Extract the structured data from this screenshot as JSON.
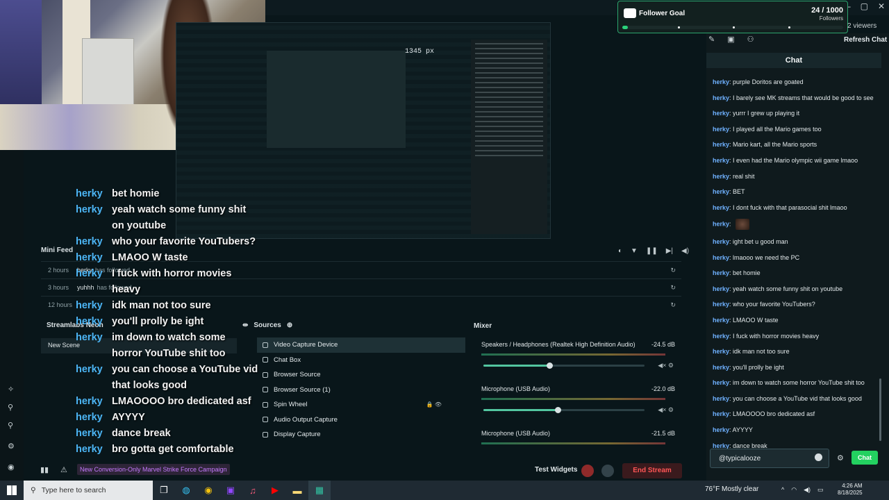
{
  "window": {
    "controls": [
      "—",
      "▢",
      "✕"
    ]
  },
  "preview": {
    "measure_label": "1345 px"
  },
  "follower_goal": {
    "title": "Follower Goal",
    "count": "24 / 1000",
    "unit": "Followers",
    "progress": 0.024,
    "accent": "#2ca56e"
  },
  "viewers": "2 viewers",
  "chat_panel": {
    "refresh_label": "Refresh Chat",
    "header": "Chat",
    "input_value": "@typicalooze",
    "send_label": "Chat",
    "messages": [
      {
        "user": "herky",
        "text": "purple Doritos are goated"
      },
      {
        "user": "herky",
        "text": "I barely see MK streams that would be good to see"
      },
      {
        "user": "herky",
        "text": "yurrr I grew up playing it"
      },
      {
        "user": "herky",
        "text": "I played all the Mario games too"
      },
      {
        "user": "herky",
        "text": "Mario kart, all the Mario sports"
      },
      {
        "user": "herky",
        "text": "I even had the Mario olympic wii game lmaoo"
      },
      {
        "user": "herky",
        "text": "real shit"
      },
      {
        "user": "herky",
        "text": "BET"
      },
      {
        "user": "herky",
        "text": "I dont fuck with that parasocial shit lmaoo"
      },
      {
        "user": "herky",
        "text": ""
      },
      {
        "user": "herky",
        "text": "ight bet u good man"
      },
      {
        "user": "herky",
        "text": "lmaooo we need the PC"
      },
      {
        "user": "herky",
        "text": "bet homie"
      },
      {
        "user": "herky",
        "text": "yeah watch some funny shit on youtube"
      },
      {
        "user": "herky",
        "text": "who your favorite YouTubers?"
      },
      {
        "user": "herky",
        "text": "LMAOO W taste"
      },
      {
        "user": "herky",
        "text": "I fuck with horror movies heavy"
      },
      {
        "user": "herky",
        "text": "idk man not too sure"
      },
      {
        "user": "herky",
        "text": "you'll prolly be ight"
      },
      {
        "user": "herky",
        "text": "im down to watch some horror YouTube shit too"
      },
      {
        "user": "herky",
        "text": "you can choose a YouTube vid that looks good"
      },
      {
        "user": "herky",
        "text": "LMAOOOO bro dedicated asf"
      },
      {
        "user": "herky",
        "text": "AYYYY"
      },
      {
        "user": "herky",
        "text": "dance break"
      },
      {
        "user": "herky",
        "text": "bro gotta get comfortable"
      }
    ]
  },
  "overlay_chat": [
    {
      "user": "herky",
      "lines": [
        "bet homie"
      ]
    },
    {
      "user": "herky",
      "lines": [
        "yeah watch some funny shit",
        "on youtube"
      ]
    },
    {
      "user": "herky",
      "lines": [
        "who your favorite YouTubers?"
      ]
    },
    {
      "user": "herky",
      "lines": [
        "LMAOO W taste"
      ]
    },
    {
      "user": "herky",
      "lines": [
        "I fuck with horror movies",
        "heavy"
      ]
    },
    {
      "user": "herky",
      "lines": [
        "idk man not too sure"
      ]
    },
    {
      "user": "herky",
      "lines": [
        "you'll prolly be ight"
      ]
    },
    {
      "user": "herky",
      "lines": [
        "im down to watch some",
        "horror YouTube shit too"
      ]
    },
    {
      "user": "herky",
      "lines": [
        "you can choose a YouTube vid",
        "that looks good"
      ]
    },
    {
      "user": "herky",
      "lines": [
        "LMAOOOO bro dedicated asf"
      ]
    },
    {
      "user": "herky",
      "lines": [
        "AYYYY"
      ]
    },
    {
      "user": "herky",
      "lines": [
        "dance break"
      ]
    },
    {
      "user": "herky",
      "lines": [
        "bro gotta get comfortable"
      ]
    }
  ],
  "mini_feed": {
    "title": "Mini Feed",
    "rows": [
      {
        "time": "2 hours",
        "who": "herky",
        "action": "has followed"
      },
      {
        "time": "3 hours",
        "who": "yuhhh",
        "action": "has followed"
      },
      {
        "time": "12 hours",
        "who": "",
        "action": ""
      }
    ]
  },
  "scenes": {
    "title": "Streamlabs Neon",
    "items": [
      "New Scene"
    ]
  },
  "sources": {
    "title": "Sources",
    "items": [
      {
        "label": "Video Capture Device",
        "selected": true
      },
      {
        "label": "Chat Box",
        "selected": false
      },
      {
        "label": "Browser Source",
        "selected": false
      },
      {
        "label": "Browser Source (1)",
        "selected": false
      },
      {
        "label": "Spin Wheel",
        "selected": false
      },
      {
        "label": "Audio Output Capture",
        "selected": false
      },
      {
        "label": "Display Capture",
        "selected": false
      }
    ]
  },
  "mixer": {
    "title": "Mixer",
    "channels": [
      {
        "name": "Speakers / Headphones (Realtek High Definition Audio)",
        "db": "-24.5 dB",
        "volume": 0.41
      },
      {
        "name": "Microphone (USB Audio)",
        "db": "-22.0 dB",
        "volume": 0.46
      },
      {
        "name": "Microphone (USB Audio)",
        "db": "-21.5 dB",
        "volume": null
      }
    ]
  },
  "status_bar": {
    "campaign": "New Conversion-Only Marvel Strike Force Campaign",
    "test_widgets": "Test Widgets",
    "end_stream": "End Stream"
  },
  "taskbar": {
    "search_placeholder": "Type here to search",
    "weather": "76°F  Mostly clear",
    "time": "4:26 AM",
    "date": "8/18/2025",
    "apps": [
      "task-view-icon",
      "edge-icon",
      "chrome-icon",
      "twitch-icon",
      "music-icon",
      "youtube-icon",
      "file-explorer-icon",
      "streamlabs-icon"
    ]
  }
}
